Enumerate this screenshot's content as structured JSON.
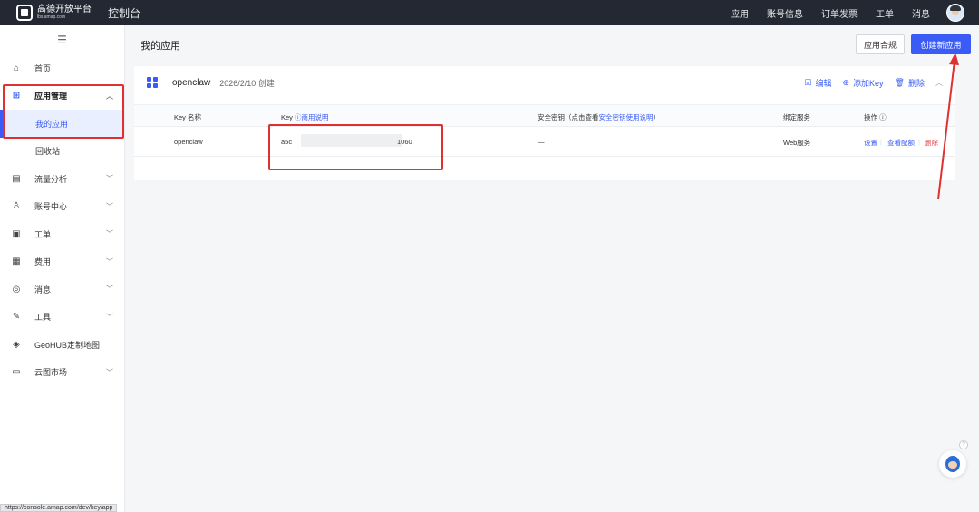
{
  "topbar": {
    "logo_name": "高德开放平台",
    "logo_sub": "lbs.amap.com",
    "console_title": "控制台",
    "nav": [
      "应用",
      "账号信息",
      "订单发票",
      "工单",
      "消息"
    ]
  },
  "sidebar": {
    "collapse_icon": "menu-icon",
    "items": [
      {
        "label": "首页",
        "icon": "home-icon"
      },
      {
        "label": "应用管理",
        "icon": "grid-icon",
        "expanded": true
      },
      {
        "label": "我的应用",
        "active": true
      },
      {
        "label": "回收站"
      },
      {
        "label": "流量分析",
        "icon": "chart-icon"
      },
      {
        "label": "账号中心",
        "icon": "user-icon"
      },
      {
        "label": "工单",
        "icon": "ticket-icon"
      },
      {
        "label": "费用",
        "icon": "billing-icon"
      },
      {
        "label": "消息",
        "icon": "message-icon"
      },
      {
        "label": "工具",
        "icon": "wrench-icon"
      },
      {
        "label": "GeoHUB定制地图",
        "icon": "layers-icon"
      },
      {
        "label": "云图市场",
        "icon": "store-icon"
      }
    ]
  },
  "main": {
    "title": "我的应用",
    "compliance_button": "应用合规",
    "create_button": "创建新应用",
    "app": {
      "name": "openclaw",
      "created": "2026/2/10 创建",
      "actions": {
        "edit": "编辑",
        "add_key": "添加Key",
        "delete": "删除"
      },
      "table": {
        "headers": {
          "key_name": "Key 名称",
          "key": "Key",
          "key_link": "商用说明",
          "secret": "安全密钥（点击查看",
          "secret_link": "安全密钥使用说明",
          "secret_close": "）",
          "service": "绑定服务",
          "ops": "操作"
        },
        "rows": [
          {
            "key_name": "openclaw",
            "key_prefix": "a5c",
            "key_suffix": "1060",
            "secret": "—",
            "service": "Web服务",
            "op_settings": "设置",
            "op_quota": "查看配额",
            "op_delete": "删除"
          }
        ]
      }
    }
  },
  "status_url": "https://console.amap.com/dev/key/app",
  "colors": {
    "accent": "#3a5bf5",
    "annotation": "#e03030",
    "topbar": "#232832"
  }
}
